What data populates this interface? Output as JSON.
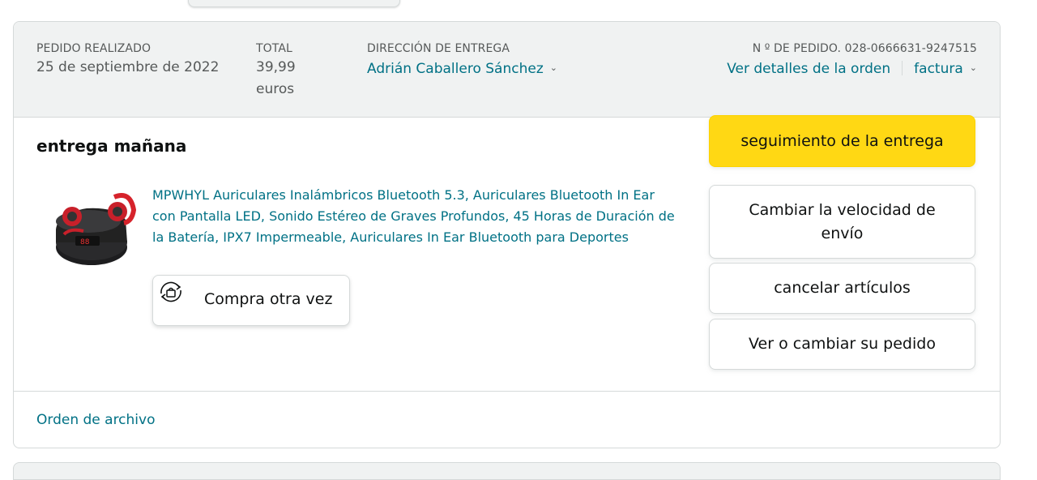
{
  "order": {
    "placed_label": "PEDIDO REALIZADO",
    "placed_date": "25 de septiembre de 2022",
    "total_label": "TOTAL",
    "total_amount": "39,99",
    "total_currency": "euros",
    "ship_to_label": "DIRECCIÓN DE ENTREGA",
    "ship_to_name": "Adrián Caballero Sánchez",
    "order_number_label": "N º DE PEDIDO. 028-0666631-9247515",
    "details_link": "Ver detalles de la orden",
    "invoice_link": "factura",
    "delivery_status": "entrega mañana",
    "product_title": "MPWHYL Auriculares Inalámbricos Bluetooth 5.3, Auriculares Bluetooth In Ear con Pantalla LED, Sonido Estéreo de Graves Profundos, 45 Horas de Duración de la Batería, IPX7 Impermeable, Auriculares In Ear Bluetooth para Deportes",
    "buy_again_label": "Compra otra vez",
    "archive_link": "Orden de archivo"
  },
  "actions": {
    "track": "seguimiento de la entrega",
    "change_speed": "Cambiar la velocidad de envío",
    "cancel_items": "cancelar artículos",
    "view_change": "Ver o cambiar su pedido"
  },
  "colors": {
    "link": "#007185",
    "primary_button": "#FFD814",
    "header_bg": "#F0F2F2",
    "border": "#D5D9D9"
  },
  "icons": {
    "chevron": "chevron-down-icon",
    "buy_again": "buy-again-icon",
    "product": "earbuds-product-image"
  }
}
